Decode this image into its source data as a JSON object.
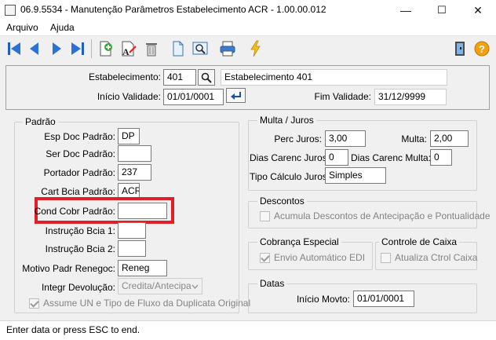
{
  "window": {
    "title": "06.9.5534 - Manutenção Parâmetros Estabelecimento ACR - 1.00.00.012",
    "controls": {
      "minimize": "—",
      "maximize": "☐",
      "close": "✕"
    }
  },
  "menu": {
    "items": [
      "Arquivo",
      "Ajuda"
    ]
  },
  "toolbar": {
    "icons": [
      "first-icon",
      "previous-icon",
      "next-icon",
      "last-icon",
      "add-icon",
      "edit-icon",
      "delete-icon",
      "new-document-icon",
      "zoom-icon",
      "print-icon",
      "execute-icon",
      "exit-icon",
      "help-icon"
    ],
    "help_glyph": "?"
  },
  "header": {
    "estabelecimento_label": "Estabelecimento:",
    "estabelecimento_code": "401",
    "estabelecimento_name": "Estabelecimento 401",
    "inicio_validade_label": "Início Validade:",
    "inicio_validade": "01/01/0001",
    "fim_validade_label": "Fim Validade:",
    "fim_validade": "31/12/9999"
  },
  "padrao": {
    "title": "Padrão",
    "esp_doc_label": "Esp Doc Padrão:",
    "esp_doc": "DP",
    "ser_doc_label": "Ser Doc Padrão:",
    "ser_doc": "",
    "portador_label": "Portador Padrão:",
    "portador": "237",
    "cart_bcia_label": "Cart Bcia Padrão:",
    "cart_bcia": "ACR",
    "cond_cobr_label": "Cond Cobr Padrão:",
    "cond_cobr": "",
    "instrucao1_label": "Instrução Bcia 1:",
    "instrucao1": "",
    "instrucao2_label": "Instrução Bcia 2:",
    "instrucao2": "",
    "motivo_label": "Motivo Padr Renegoc:",
    "motivo": "Reneg",
    "integr_label": "Integr Devolução:",
    "integr": "Credita/Antecipa",
    "assume_label": "Assume UN e Tipo de Fluxo da Duplicata Original",
    "assume_checked": true
  },
  "multa_juros": {
    "title": "Multa / Juros",
    "perc_juros_label": "Perc Juros:",
    "perc_juros": "3,00",
    "multa_label": "Multa:",
    "multa": "2,00",
    "dias_carenc_juros_label": "Dias Carenc Juros:",
    "dias_carenc_juros": "0",
    "dias_carenc_multa_label": "Dias Carenc Multa:",
    "dias_carenc_multa": "0",
    "tipo_calculo_label": "Tipo Cálculo Juros:",
    "tipo_calculo": "Simples"
  },
  "descontos": {
    "title": "Descontos",
    "acumula_label": "Acumula Descontos de Antecipação e Pontualidade",
    "acumula_checked": false
  },
  "cobranca": {
    "title": "Cobrança Especial",
    "envio_label": "Envio Automático EDI",
    "envio_checked": true
  },
  "controle_caixa": {
    "title": "Controle de Caixa",
    "atualiza_label": "Atualiza Ctrol Caixa",
    "atualiza_checked": false
  },
  "datas": {
    "title": "Datas",
    "inicio_movto_label": "Início Movto:",
    "inicio_movto": "01/01/0001"
  },
  "status": {
    "text": "Enter data or press ESC to end."
  }
}
